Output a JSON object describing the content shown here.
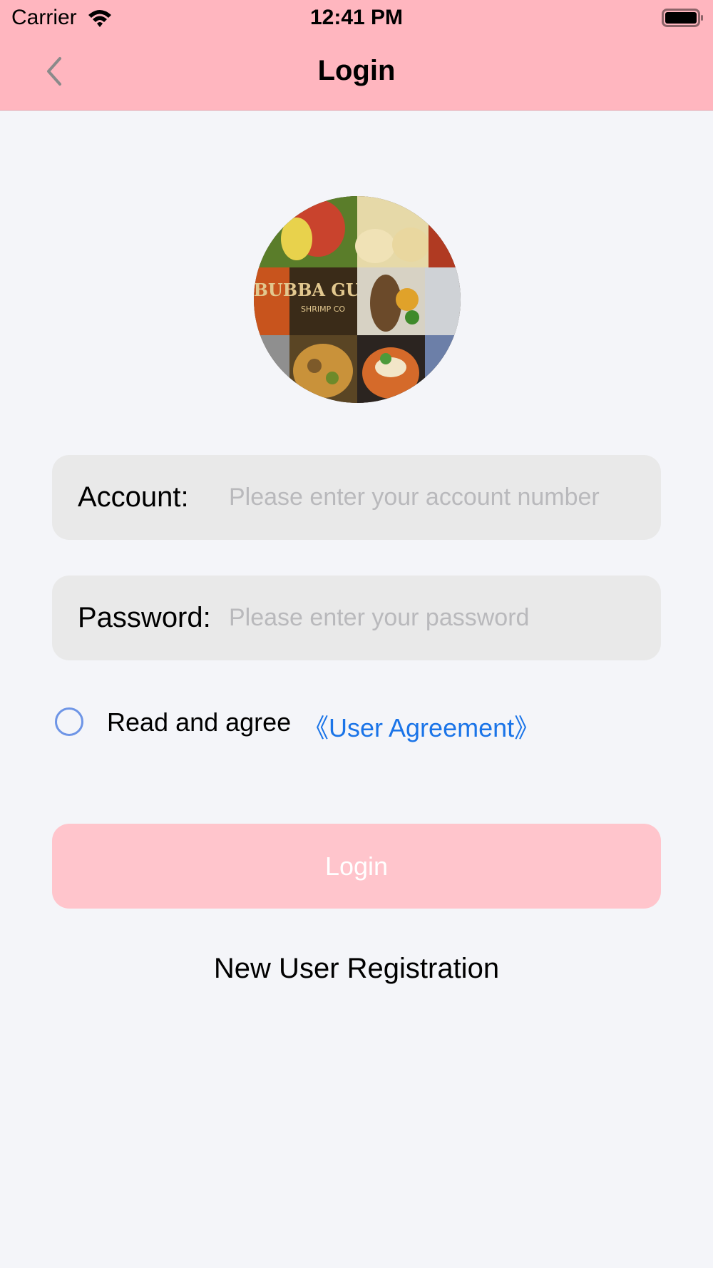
{
  "status_bar": {
    "carrier": "Carrier",
    "time": "12:41 PM"
  },
  "nav": {
    "title": "Login",
    "back_icon": "chevron-left-icon"
  },
  "avatar": {
    "description_icon": "food-collage-avatar"
  },
  "form": {
    "account_label": "Account:",
    "account_placeholder": "Please enter your account number",
    "account_value": "",
    "password_label": "Password:",
    "password_placeholder": "Please enter your password",
    "password_value": ""
  },
  "agreement": {
    "text": "Read and agree",
    "link": "《User Agreement》",
    "checked": false
  },
  "login_button": "Login",
  "register_link": "New User Registration",
  "colors": {
    "header_bg": "#ffb6bf",
    "login_button_bg": "#ffc5cc",
    "link": "#1a74e8",
    "page_bg": "#f4f5f9"
  }
}
